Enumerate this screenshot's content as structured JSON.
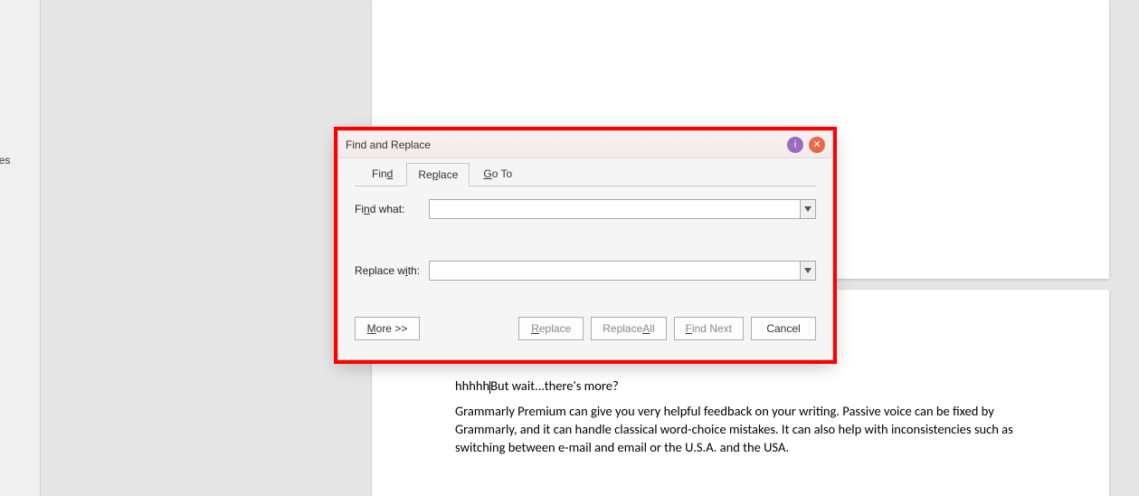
{
  "sidebar": {
    "label_fragment": "yles"
  },
  "document": {
    "line1_a": "hhhhh",
    "line1_b": "But wait...there's more?",
    "para2": "Grammarly Premium can give you very helpful feedback on your writing. Passive voice can be fixed by Grammarly, and it can handle classical word-choice mistakes. It can also help with inconsistencies such as switching between e-mail and email or the U.S.A. and the USA."
  },
  "dialog": {
    "title": "Find and Replace",
    "info_glyph": "i",
    "close_glyph": "✕",
    "tabs": {
      "find_pre": "Fin",
      "find_u": "d",
      "replace_pre": "Re",
      "replace_u": "p",
      "replace_post": "lace",
      "goto_u": "G",
      "goto_post": "o To"
    },
    "find_label_pre": "Fi",
    "find_label_u": "n",
    "find_label_post": "d what:",
    "find_value": "",
    "replace_label_pre": "Replace w",
    "replace_label_u": "i",
    "replace_label_post": "th:",
    "replace_value": "",
    "buttons": {
      "more_u": "M",
      "more_post": "ore >>",
      "replace_u": "R",
      "replace_post": "eplace",
      "replace_all_pre": "Replace ",
      "replace_all_u": "A",
      "replace_all_post": "ll",
      "find_next_u": "F",
      "find_next_post": "ind Next",
      "cancel": "Cancel"
    }
  }
}
